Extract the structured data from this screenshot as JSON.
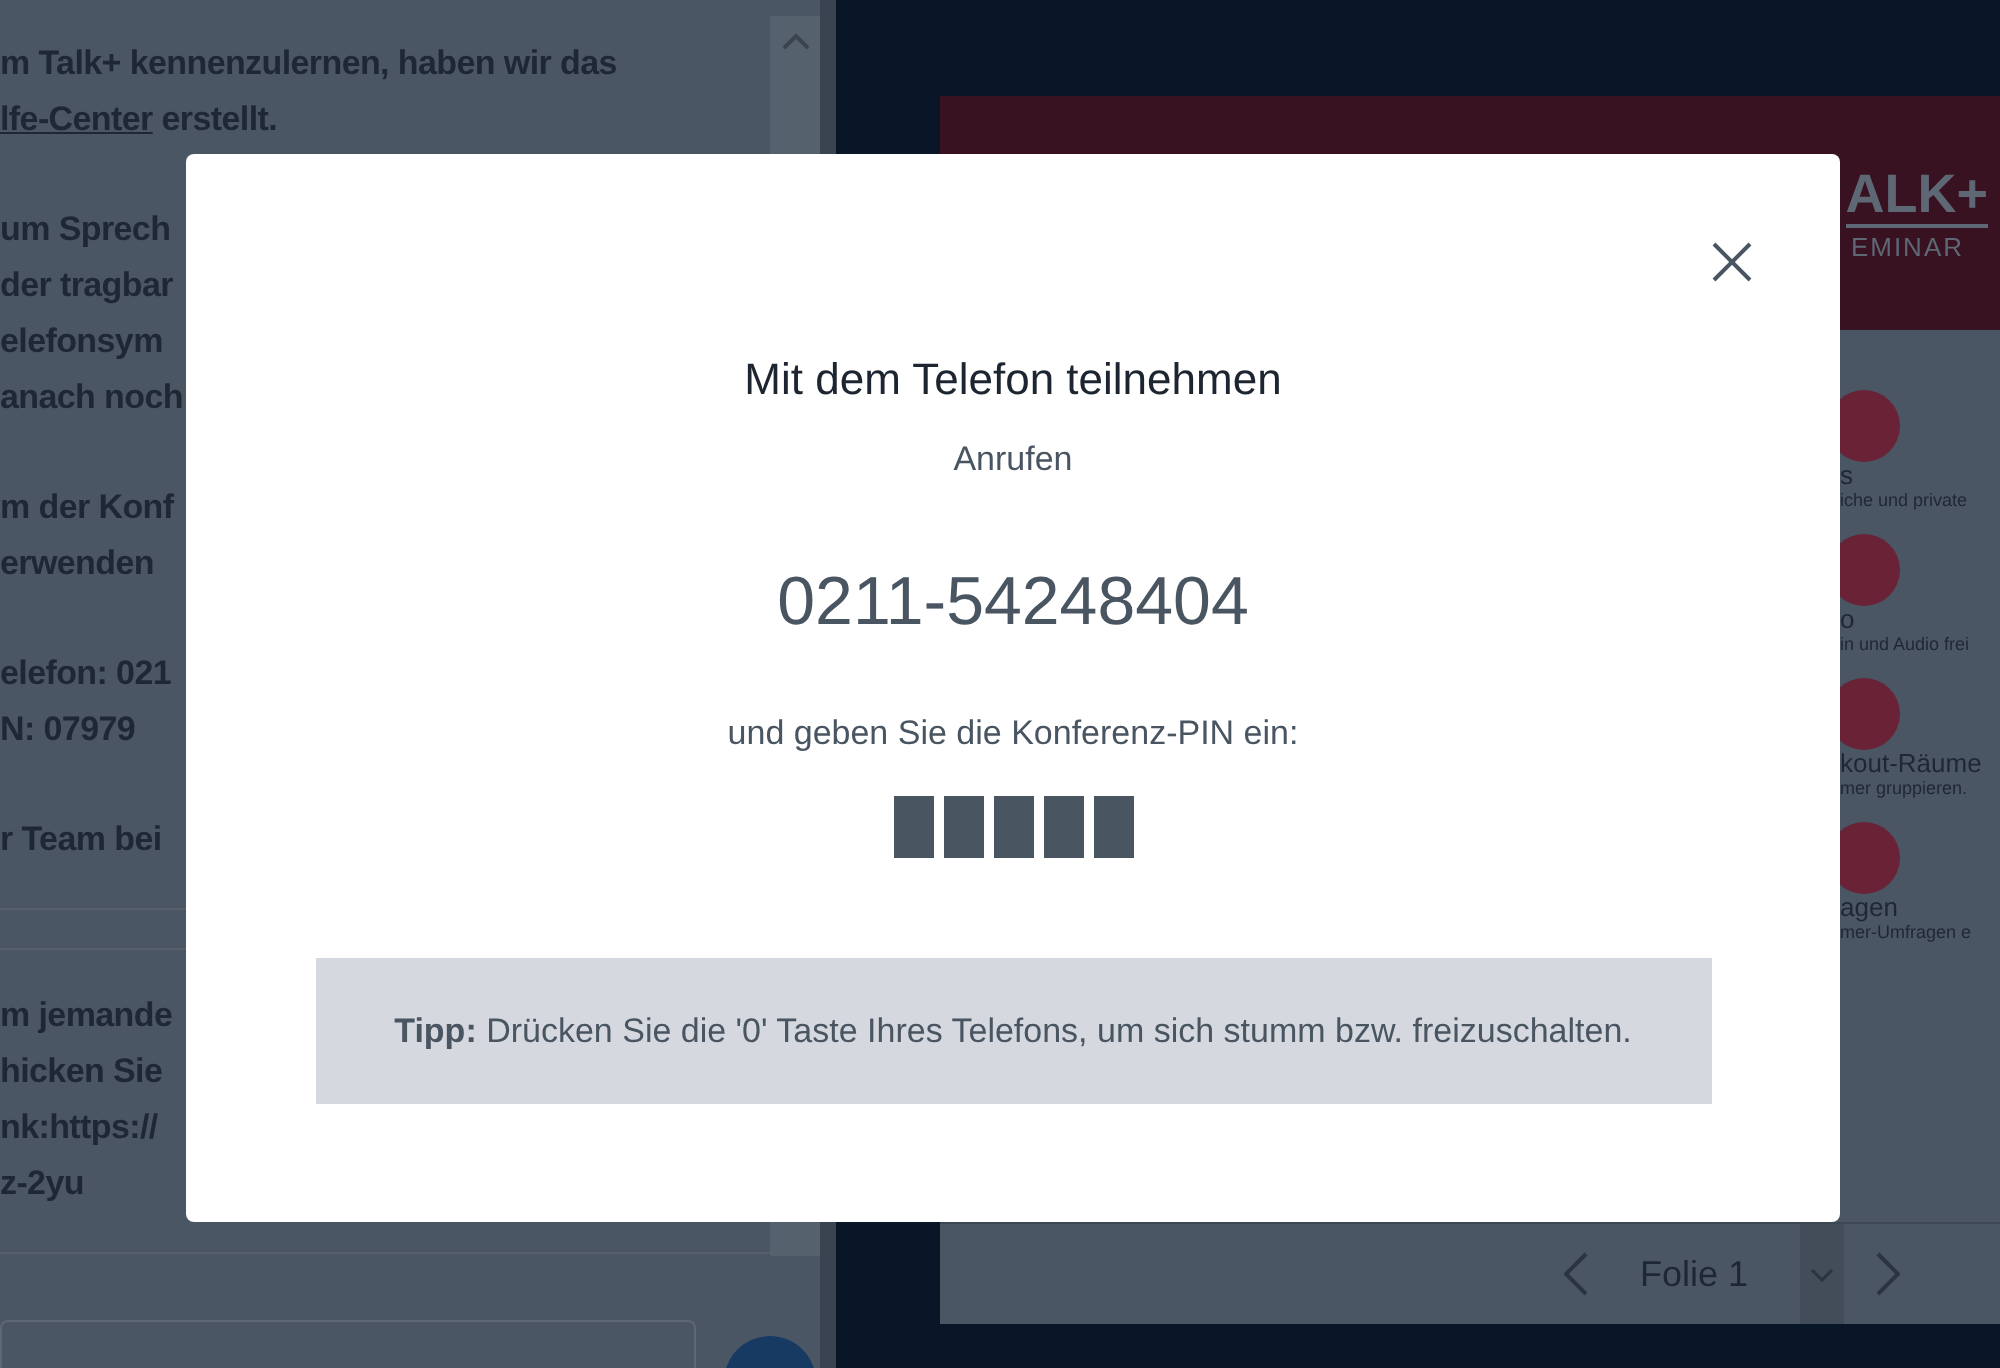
{
  "chat": {
    "messages": [
      {
        "paragraphs": [
          [
            {
              "text": "m Talk+ kennenzulernen, haben wir das"
            },
            {
              "link": "lfe-Center",
              "text": " erstellt."
            }
          ],
          [
            {
              "text": "um Sprech"
            },
            {
              "text": "der tragbar"
            },
            {
              "text": "elefonsym"
            },
            {
              "text": "anach noch"
            }
          ],
          [
            {
              "text": "m der Konf"
            },
            {
              "text": "erwenden"
            }
          ],
          [
            {
              "text": "elefon: 021"
            },
            {
              "text": "N: 07979"
            }
          ],
          [
            {
              "text": "r Team bei"
            }
          ]
        ]
      },
      {
        "paragraphs": [
          [
            {
              "text": "m jemande"
            },
            {
              "text": "hicken Sie"
            },
            {
              "text": "nk:https://"
            },
            {
              "text": "z-2yu"
            }
          ]
        ]
      }
    ]
  },
  "slide": {
    "logo": "ALK+",
    "logo_sub": "EMINAR",
    "features": [
      {
        "title": "s",
        "text": "iche und private"
      },
      {
        "title": "o",
        "text": "in und Audio frei"
      },
      {
        "title": "kout-Räume",
        "text": "mer gruppieren."
      },
      {
        "title": "agen",
        "text": "mer-Umfragen e"
      }
    ],
    "nav": {
      "page": "Folie 1"
    }
  },
  "dialog": {
    "title": "Mit dem Telefon teilnehmen",
    "call_label": "Anrufen",
    "number": "0211-54248404",
    "pin_label": "und geben Sie die Konferenz-PIN ein:",
    "pin_digits": [
      {
        "kind": "masked"
      },
      {
        "kind": "masked"
      },
      {
        "kind": "masked"
      },
      {
        "kind": "masked"
      },
      {
        "kind": "masked"
      }
    ],
    "tip": "**Tipp:** Drücken Sie die '0' Taste Ihres Telefons, um sich stumm bzw. freizuschalten."
  }
}
